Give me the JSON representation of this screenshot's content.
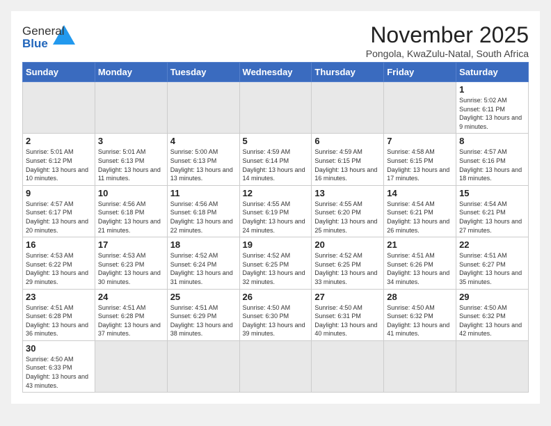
{
  "logo": {
    "line1": "General",
    "line2": "Blue"
  },
  "title": "November 2025",
  "subtitle": "Pongola, KwaZulu-Natal, South Africa",
  "days_of_week": [
    "Sunday",
    "Monday",
    "Tuesday",
    "Wednesday",
    "Thursday",
    "Friday",
    "Saturday"
  ],
  "weeks": [
    [
      {
        "day": "",
        "info": ""
      },
      {
        "day": "",
        "info": ""
      },
      {
        "day": "",
        "info": ""
      },
      {
        "day": "",
        "info": ""
      },
      {
        "day": "",
        "info": ""
      },
      {
        "day": "",
        "info": ""
      },
      {
        "day": "1",
        "info": "Sunrise: 5:02 AM\nSunset: 6:11 PM\nDaylight: 13 hours\nand 9 minutes."
      }
    ],
    [
      {
        "day": "2",
        "info": "Sunrise: 5:01 AM\nSunset: 6:12 PM\nDaylight: 13 hours\nand 10 minutes."
      },
      {
        "day": "3",
        "info": "Sunrise: 5:01 AM\nSunset: 6:13 PM\nDaylight: 13 hours\nand 11 minutes."
      },
      {
        "day": "4",
        "info": "Sunrise: 5:00 AM\nSunset: 6:13 PM\nDaylight: 13 hours\nand 13 minutes."
      },
      {
        "day": "5",
        "info": "Sunrise: 4:59 AM\nSunset: 6:14 PM\nDaylight: 13 hours\nand 14 minutes."
      },
      {
        "day": "6",
        "info": "Sunrise: 4:59 AM\nSunset: 6:15 PM\nDaylight: 13 hours\nand 16 minutes."
      },
      {
        "day": "7",
        "info": "Sunrise: 4:58 AM\nSunset: 6:15 PM\nDaylight: 13 hours\nand 17 minutes."
      },
      {
        "day": "8",
        "info": "Sunrise: 4:57 AM\nSunset: 6:16 PM\nDaylight: 13 hours\nand 18 minutes."
      }
    ],
    [
      {
        "day": "9",
        "info": "Sunrise: 4:57 AM\nSunset: 6:17 PM\nDaylight: 13 hours\nand 20 minutes."
      },
      {
        "day": "10",
        "info": "Sunrise: 4:56 AM\nSunset: 6:18 PM\nDaylight: 13 hours\nand 21 minutes."
      },
      {
        "day": "11",
        "info": "Sunrise: 4:56 AM\nSunset: 6:18 PM\nDaylight: 13 hours\nand 22 minutes."
      },
      {
        "day": "12",
        "info": "Sunrise: 4:55 AM\nSunset: 6:19 PM\nDaylight: 13 hours\nand 24 minutes."
      },
      {
        "day": "13",
        "info": "Sunrise: 4:55 AM\nSunset: 6:20 PM\nDaylight: 13 hours\nand 25 minutes."
      },
      {
        "day": "14",
        "info": "Sunrise: 4:54 AM\nSunset: 6:21 PM\nDaylight: 13 hours\nand 26 minutes."
      },
      {
        "day": "15",
        "info": "Sunrise: 4:54 AM\nSunset: 6:21 PM\nDaylight: 13 hours\nand 27 minutes."
      }
    ],
    [
      {
        "day": "16",
        "info": "Sunrise: 4:53 AM\nSunset: 6:22 PM\nDaylight: 13 hours\nand 29 minutes."
      },
      {
        "day": "17",
        "info": "Sunrise: 4:53 AM\nSunset: 6:23 PM\nDaylight: 13 hours\nand 30 minutes."
      },
      {
        "day": "18",
        "info": "Sunrise: 4:52 AM\nSunset: 6:24 PM\nDaylight: 13 hours\nand 31 minutes."
      },
      {
        "day": "19",
        "info": "Sunrise: 4:52 AM\nSunset: 6:25 PM\nDaylight: 13 hours\nand 32 minutes."
      },
      {
        "day": "20",
        "info": "Sunrise: 4:52 AM\nSunset: 6:25 PM\nDaylight: 13 hours\nand 33 minutes."
      },
      {
        "day": "21",
        "info": "Sunrise: 4:51 AM\nSunset: 6:26 PM\nDaylight: 13 hours\nand 34 minutes."
      },
      {
        "day": "22",
        "info": "Sunrise: 4:51 AM\nSunset: 6:27 PM\nDaylight: 13 hours\nand 35 minutes."
      }
    ],
    [
      {
        "day": "23",
        "info": "Sunrise: 4:51 AM\nSunset: 6:28 PM\nDaylight: 13 hours\nand 36 minutes."
      },
      {
        "day": "24",
        "info": "Sunrise: 4:51 AM\nSunset: 6:28 PM\nDaylight: 13 hours\nand 37 minutes."
      },
      {
        "day": "25",
        "info": "Sunrise: 4:51 AM\nSunset: 6:29 PM\nDaylight: 13 hours\nand 38 minutes."
      },
      {
        "day": "26",
        "info": "Sunrise: 4:50 AM\nSunset: 6:30 PM\nDaylight: 13 hours\nand 39 minutes."
      },
      {
        "day": "27",
        "info": "Sunrise: 4:50 AM\nSunset: 6:31 PM\nDaylight: 13 hours\nand 40 minutes."
      },
      {
        "day": "28",
        "info": "Sunrise: 4:50 AM\nSunset: 6:32 PM\nDaylight: 13 hours\nand 41 minutes."
      },
      {
        "day": "29",
        "info": "Sunrise: 4:50 AM\nSunset: 6:32 PM\nDaylight: 13 hours\nand 42 minutes."
      }
    ],
    [
      {
        "day": "30",
        "info": "Sunrise: 4:50 AM\nSunset: 6:33 PM\nDaylight: 13 hours\nand 43 minutes."
      },
      {
        "day": "",
        "info": ""
      },
      {
        "day": "",
        "info": ""
      },
      {
        "day": "",
        "info": ""
      },
      {
        "day": "",
        "info": ""
      },
      {
        "day": "",
        "info": ""
      },
      {
        "day": "",
        "info": ""
      }
    ]
  ]
}
